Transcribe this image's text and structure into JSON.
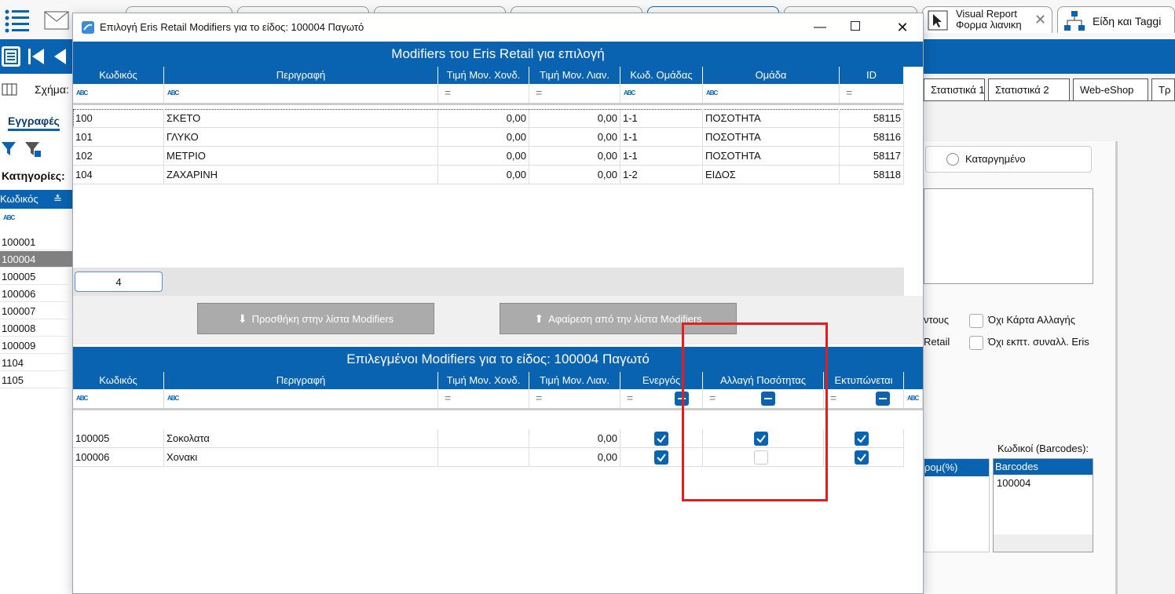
{
  "background": {
    "tabs": [
      {
        "label": "Visual Report Φορμα λιανικη"
      },
      {
        "label": "Είδη και Taggi"
      }
    ],
    "left_panel": {
      "schema_label": "Σχήμα:",
      "records_label": "Εγγραφές",
      "categories_label": "Κατηγορίες:",
      "code_header": "Κωδικός",
      "codes": [
        "100001",
        "100004",
        "100005",
        "100006",
        "100007",
        "100008",
        "100009",
        "1104",
        "1105"
      ],
      "selected_index": 1
    },
    "right_panel": {
      "tabs": [
        "Στατιστικά 1",
        "Στατιστικά 2",
        "Web-eShop",
        "Τρ"
      ],
      "cancelled_label": "Καταργημένο",
      "partial_label_1": "ντους",
      "partial_label_2": "Retail",
      "no_change_card_label": "Όχι Κάρτα Αλλαγής",
      "no_discount_label": "Όχι εκπτ. συναλλ. Eris",
      "partial_column": "ρομ(%)",
      "barcodes_title": "Κωδικοί (Barcodes):",
      "barcodes_header": "Barcodes",
      "barcodes": [
        "100004"
      ]
    }
  },
  "dialog": {
    "title": "Επιλογή Eris Retail Modifiers για το είδος: 100004  Παγωτό",
    "top_section_title": "Modifiers του Eris Retail για επιλογή",
    "top_columns": [
      "Κωδικός",
      "Περιγραφή",
      "Τιμή Μον. Χονδ.",
      "Τιμή Μον. Λιαν.",
      "Κωδ. Ομάδας",
      "Ομάδα",
      "ID"
    ],
    "top_rows": [
      {
        "code": "100",
        "desc": "ΣΚΕΤΟ",
        "wholesale": "0,00",
        "retail": "0,00",
        "group_code": "1-1",
        "group": "ΠΟΣΟΤΗΤΑ",
        "id": "58115"
      },
      {
        "code": "101",
        "desc": "ΓΛΥΚΟ",
        "wholesale": "0,00",
        "retail": "0,00",
        "group_code": "1-1",
        "group": "ΠΟΣΟΤΗΤΑ",
        "id": "58116"
      },
      {
        "code": "102",
        "desc": "ΜΕΤΡΙΟ",
        "wholesale": "0,00",
        "retail": "0,00",
        "group_code": "1-1",
        "group": "ΠΟΣΟΤΗΤΑ",
        "id": "58117"
      },
      {
        "code": "104",
        "desc": "ΖΑΧΑΡΙΝΗ",
        "wholesale": "0,00",
        "retail": "0,00",
        "group_code": "1-2",
        "group": "ΕΙΔΟΣ",
        "id": "58118"
      }
    ],
    "record_count": "4",
    "add_button": "Προσθήκη στην λίστα Modifiers",
    "remove_button": "Αφαίρεση από την λίστα Modifiers",
    "bottom_section_title": "Επιλεγμένοι Modifiers για το είδος: 100004  Παγωτό",
    "bottom_columns": [
      "Κωδικός",
      "Περιγραφή",
      "Τιμή Μον. Χονδ.",
      "Τιμή Μον. Λιαν.",
      "Ενεργός",
      "Αλλαγή Ποσότητας",
      "Εκτυπώνεται"
    ],
    "bottom_rows": [
      {
        "code": "100005",
        "desc": "Σοκολατα",
        "wholesale": "",
        "retail": "0,00",
        "active": true,
        "qty_change": true,
        "printed": true
      },
      {
        "code": "100006",
        "desc": "Χονακι",
        "wholesale": "",
        "retail": "0,00",
        "active": true,
        "qty_change": false,
        "printed": true
      }
    ],
    "highlight_color": "#e02020",
    "accent_color": "#0a63b0"
  }
}
